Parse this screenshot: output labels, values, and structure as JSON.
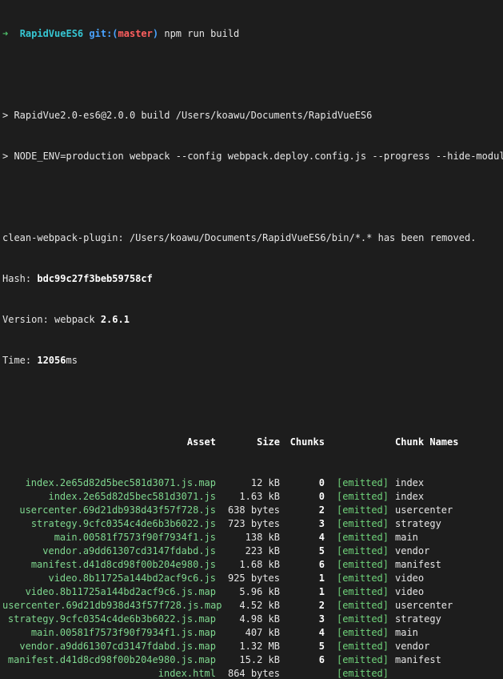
{
  "prompt": {
    "arrow": "➜",
    "dir": "RapidVueES6",
    "git_label": "git:(",
    "branch": "master",
    "git_close": ")",
    "command": "npm run build"
  },
  "lines": {
    "build_line": "> RapidVue2.0-es6@2.0.0 build /Users/koawu/Documents/RapidVueES6",
    "env_line": "> NODE_ENV=production webpack --config webpack.deploy.config.js --progress --hide-modules",
    "clean_line": "clean-webpack-plugin: /Users/koawu/Documents/RapidVueES6/bin/*.* has been removed.",
    "hash_label": "Hash: ",
    "hash_value": "bdc99c27f3beb59758cf",
    "version_label": "Version: webpack ",
    "version_value": "2.6.1",
    "time_label": "Time: ",
    "time_value": "12056",
    "time_unit": "ms"
  },
  "table": {
    "headers": {
      "asset": "Asset",
      "size": "Size",
      "chunks": "Chunks",
      "chunk_names": "Chunk Names"
    },
    "rows": [
      {
        "asset": "index.2e65d82d5bec581d3071.js.map",
        "size": "12 kB",
        "chunk": "0",
        "emitted": "[emitted]",
        "name": "index"
      },
      {
        "asset": "index.2e65d82d5bec581d3071.js",
        "size": "1.63 kB",
        "chunk": "0",
        "emitted": "[emitted]",
        "name": "index"
      },
      {
        "asset": "usercenter.69d21db938d43f57f728.js",
        "size": "638 bytes",
        "chunk": "2",
        "emitted": "[emitted]",
        "name": "usercenter"
      },
      {
        "asset": "strategy.9cfc0354c4de6b3b6022.js",
        "size": "723 bytes",
        "chunk": "3",
        "emitted": "[emitted]",
        "name": "strategy"
      },
      {
        "asset": "main.00581f7573f90f7934f1.js",
        "size": "138 kB",
        "chunk": "4",
        "emitted": "[emitted]",
        "name": "main"
      },
      {
        "asset": "vendor.a9dd61307cd3147fdabd.js",
        "size": "223 kB",
        "chunk": "5",
        "emitted": "[emitted]",
        "name": "vendor"
      },
      {
        "asset": "manifest.d41d8cd98f00b204e980.js",
        "size": "1.68 kB",
        "chunk": "6",
        "emitted": "[emitted]",
        "name": "manifest"
      },
      {
        "asset": "video.8b11725a144bd2acf9c6.js",
        "size": "925 bytes",
        "chunk": "1",
        "emitted": "[emitted]",
        "name": "video"
      },
      {
        "asset": "video.8b11725a144bd2acf9c6.js.map",
        "size": "5.96 kB",
        "chunk": "1",
        "emitted": "[emitted]",
        "name": "video"
      },
      {
        "asset": "usercenter.69d21db938d43f57f728.js.map",
        "size": "4.52 kB",
        "chunk": "2",
        "emitted": "[emitted]",
        "name": "usercenter"
      },
      {
        "asset": "strategy.9cfc0354c4de6b3b6022.js.map",
        "size": "4.98 kB",
        "chunk": "3",
        "emitted": "[emitted]",
        "name": "strategy"
      },
      {
        "asset": "main.00581f7573f90f7934f1.js.map",
        "size": "407 kB",
        "chunk": "4",
        "emitted": "[emitted]",
        "name": "main"
      },
      {
        "asset": "vendor.a9dd61307cd3147fdabd.js.map",
        "size": "1.32 MB",
        "chunk": "5",
        "emitted": "[emitted]",
        "name": "vendor"
      },
      {
        "asset": "manifest.d41d8cd98f00b204e980.js.map",
        "size": "15.2 kB",
        "chunk": "6",
        "emitted": "[emitted]",
        "name": "manifest"
      },
      {
        "asset": "index.html",
        "size": "864 bytes",
        "chunk": "",
        "emitted": "[emitted]",
        "name": ""
      }
    ]
  },
  "colors": {
    "background": "#1d1d1d",
    "text": "#e6e6e6",
    "green": "#7fd88f",
    "cyan": "#36c6d3",
    "blue": "#4aa3ff",
    "red": "#ff5f5f"
  }
}
